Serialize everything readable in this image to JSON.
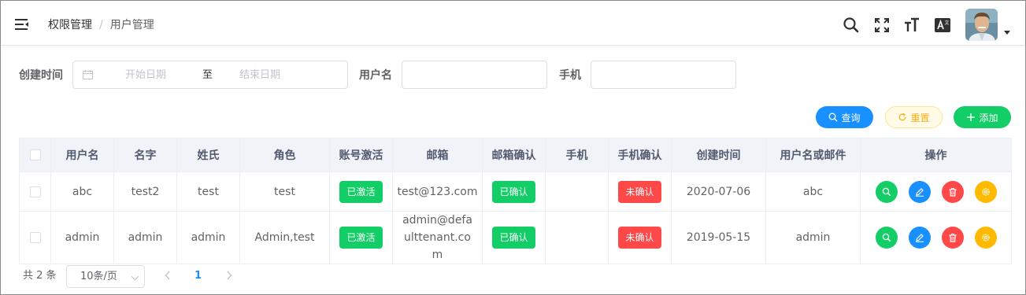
{
  "header": {
    "breadcrumb": [
      "权限管理",
      "用户管理"
    ],
    "breadcrumb_sep": "/",
    "icons": [
      "search-icon",
      "fullscreen-icon",
      "font-size-icon",
      "translate-icon"
    ]
  },
  "filters": {
    "created_label": "创建时间",
    "start_placeholder": "开始日期",
    "range_separator": "至",
    "end_placeholder": "结束日期",
    "username_label": "用户名",
    "username_value": "",
    "phone_label": "手机",
    "phone_value": ""
  },
  "actions": {
    "search": "查询",
    "reset": "重置",
    "add": "添加"
  },
  "table": {
    "columns": [
      "用户名",
      "名字",
      "姓氏",
      "角色",
      "账号激活",
      "邮箱",
      "邮箱确认",
      "手机",
      "手机确认",
      "创建时间",
      "用户名或邮件",
      "操作"
    ],
    "rows": [
      {
        "username": "abc",
        "name": "test2",
        "surname": "test",
        "roles": "test",
        "active": "已激活",
        "email": "test@123.com",
        "email_confirmed": "已确认",
        "phone": "",
        "phone_confirmed": "未确认",
        "created": "2020-07-06",
        "login": "abc"
      },
      {
        "username": "admin",
        "name": "admin",
        "surname": "admin",
        "roles": "Admin,test",
        "active": "已激活",
        "email": "admin@defaulttenant.com",
        "email_confirmed": "已确认",
        "phone": "",
        "phone_confirmed": "未确认",
        "created": "2019-05-15",
        "login": "admin"
      }
    ]
  },
  "pagination": {
    "total": "共 2 条",
    "page_size": "10条/页",
    "current_page": "1"
  },
  "colors": {
    "primary": "#1890ff",
    "success": "#13ce66",
    "danger": "#ff4949",
    "warning": "#ffba00"
  }
}
